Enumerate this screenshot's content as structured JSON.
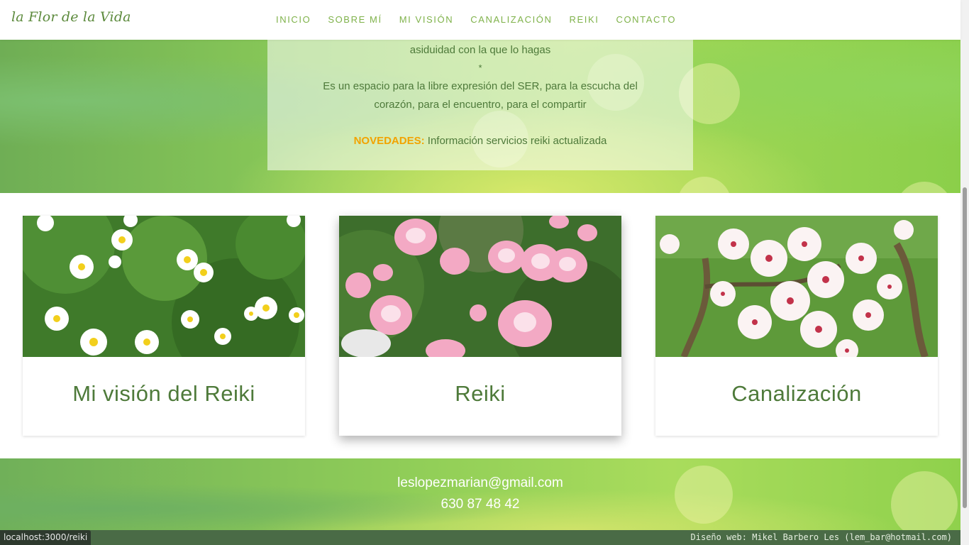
{
  "brand": {
    "name": "la Flor de la Vida"
  },
  "nav": {
    "items": [
      {
        "label": "INICIO"
      },
      {
        "label": "SOBRE MÍ"
      },
      {
        "label": "MI VISIÓN"
      },
      {
        "label": "CANALIZACIÓN"
      },
      {
        "label": "REIKI"
      },
      {
        "label": "CONTACTO"
      }
    ]
  },
  "hero": {
    "line1": "asiduidad con la que lo hagas",
    "separator": "*",
    "line2": "Es un espacio para la libre expresión del SER, para la escucha del",
    "line3": "corazón, para el encuentro, para el compartir",
    "news_label": "NOVEDADES:",
    "news_text": " Información servicios reiki actualizada"
  },
  "cards": [
    {
      "title": "Mi visión del Reiki",
      "image": "daisies-photo"
    },
    {
      "title": "Reiki",
      "image": "pink-tulips-photo"
    },
    {
      "title": "Canalización",
      "image": "almond-blossom-photo"
    }
  ],
  "footer": {
    "email": "leslopezmarian@gmail.com",
    "phone": "630 87 48 42",
    "credit": "Diseño web: Mikel Barbero Les (lem_bar@hotmail.com)"
  },
  "browser": {
    "status_url": "localhost:3000/reiki"
  },
  "colors": {
    "accent_green": "#7fb24a",
    "title_green": "#4e7a3a",
    "highlight_orange": "#f2a300"
  }
}
